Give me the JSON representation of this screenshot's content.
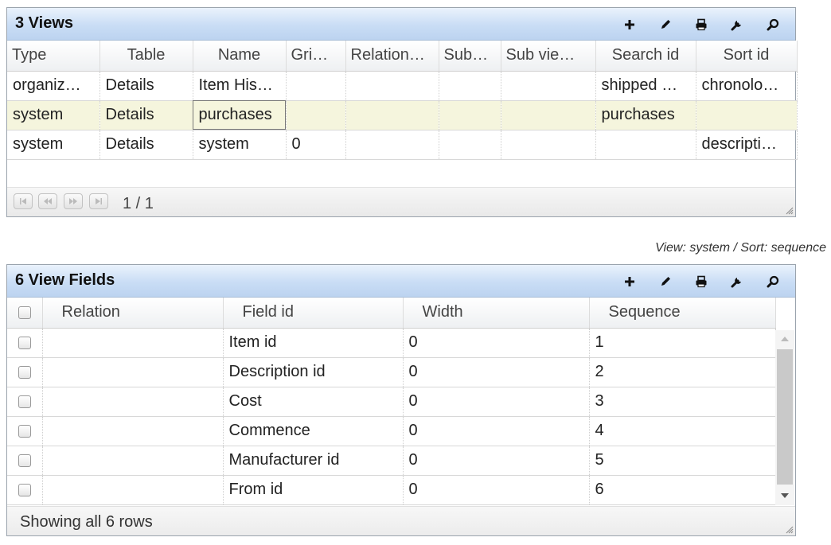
{
  "views_panel": {
    "title": "3 Views",
    "columns": [
      "Type",
      "Table",
      "Name",
      "Gri…",
      "Relation…",
      "Sub…",
      "Sub vie…",
      "Search id",
      "Sort id"
    ],
    "rows": [
      [
        "organiz…",
        "Details",
        "Item His…",
        "",
        "",
        "",
        "",
        "shipped …",
        "chronolo…"
      ],
      [
        "system",
        "Details",
        "purchases",
        "",
        "",
        "",
        "",
        "purchases",
        ""
      ],
      [
        "system",
        "Details",
        "system",
        "0",
        "",
        "",
        "",
        "",
        "descripti…"
      ]
    ],
    "pager_text": "1 / 1"
  },
  "caption": "View: system / Sort: sequence",
  "fields_panel": {
    "title": "6 View Fields",
    "columns": [
      "Relation",
      "Field id",
      "Width",
      "Sequence"
    ],
    "rows": [
      [
        "",
        "Item id",
        "0",
        "1"
      ],
      [
        "",
        "Description id",
        "0",
        "2"
      ],
      [
        "",
        "Cost",
        "0",
        "3"
      ],
      [
        "",
        "Commence",
        "0",
        "4"
      ],
      [
        "",
        "Manufacturer id",
        "0",
        "5"
      ],
      [
        "",
        "From id",
        "0",
        "6"
      ]
    ],
    "status_text": "Showing all 6 rows"
  },
  "toolbar_icons": [
    "plus-icon",
    "pencil-icon",
    "print-icon",
    "wrench-icon",
    "search-icon"
  ]
}
